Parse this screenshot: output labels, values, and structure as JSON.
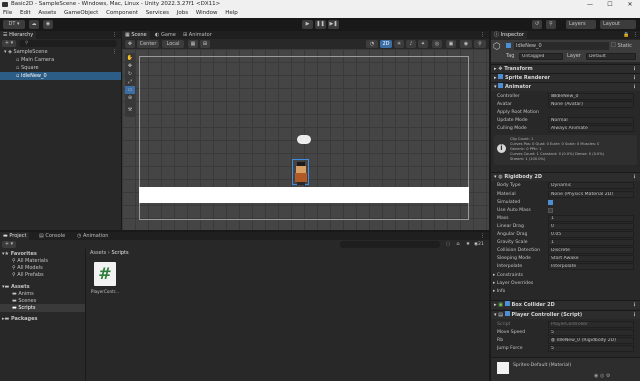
{
  "window": {
    "title": "Basic2D - SampleScene - Windows, Mac, Linux - Unity 2022.3.27f1 <DX11>",
    "min": "—",
    "max": "☐",
    "close": "✕"
  },
  "menu": [
    "File",
    "Edit",
    "Assets",
    "GameObject",
    "Component",
    "Services",
    "Jobs",
    "Window",
    "Help"
  ],
  "toolbar": {
    "account": "DT ▾",
    "play": "▶",
    "pause": "❚❚",
    "step": "▶❚",
    "layers": "Layers",
    "layout": "Layout"
  },
  "hierarchy": {
    "tab": "Hierarchy",
    "add": "+ ▾",
    "search_placeholder": "All",
    "scene": "SampleScene",
    "items": [
      "Main Camera",
      "Square",
      "IdleNew_0"
    ]
  },
  "scene": {
    "tabs": [
      "Scene",
      "Game",
      "Animator"
    ],
    "pivot": "Center",
    "space": "Local",
    "mode2d": "2D"
  },
  "project": {
    "tabs": [
      "Project",
      "Console",
      "Animation"
    ],
    "count": "21",
    "favorites_label": "Favorites",
    "favorites": [
      "All Materials",
      "All Models",
      "All Prefabs"
    ],
    "assets_label": "Assets",
    "assets": [
      "Anims",
      "Scenes",
      "Scripts"
    ],
    "packages_label": "Packages",
    "breadcrumb": [
      "Assets",
      "Scripts"
    ],
    "file_label": "PlayerContr...",
    "file_glyph": "#"
  },
  "inspector": {
    "tab": "Inspector",
    "object_name": "IdleNew_0",
    "static": "Static",
    "tag_label": "Tag",
    "tag": "Untagged",
    "layer_label": "Layer",
    "layer": "Default",
    "components": {
      "transform": "Transform",
      "sprite": "Sprite Renderer",
      "animator": "Animator",
      "rigidbody": "Rigidbody 2D",
      "box": "Box Collider 2D",
      "script": "Player Controller (Script)"
    },
    "animator_fields": [
      [
        "Controller",
        "IdleNew_0"
      ],
      [
        "Avatar",
        "None (Avatar)"
      ],
      [
        "Apply Root Motion",
        ""
      ],
      [
        "Update Mode",
        "Normal"
      ],
      [
        "Culling Mode",
        "Always Animate"
      ]
    ],
    "clip_info": [
      "Clip Count: 1",
      "Curves Pos: 0 Quat: 0 Euler: 0 Scale: 0 Muscles: 0",
      "Generic: 0 PPtr: 1",
      "Curves Count: 1 Constant: 0 (0.0%) Dense: 0 (0.0%)",
      "Stream: 1 (100.0%)"
    ],
    "rb_fields": [
      [
        "Body Type",
        "Dynamic"
      ],
      [
        "Material",
        "None (Physics Material 2D)"
      ],
      [
        "Simulated",
        ""
      ],
      [
        "Use Auto Mass",
        ""
      ],
      [
        "Mass",
        "1"
      ],
      [
        "Linear Drag",
        "0"
      ],
      [
        "Angular Drag",
        "0.05"
      ],
      [
        "Gravity Scale",
        "1"
      ],
      [
        "Collision Detection",
        "Discrete"
      ],
      [
        "Sleeping Mode",
        "Start Awake"
      ],
      [
        "Interpolate",
        "Interpolate"
      ]
    ],
    "rb_foldouts": [
      "Constraints",
      "Layer Overrides",
      "Info"
    ],
    "script_fields": [
      [
        "Script",
        "PlayerController"
      ],
      [
        "Move Speed",
        "5"
      ],
      [
        "Rb",
        "IdleNew_0 (Rigidbody 2D)"
      ],
      [
        "Jump Force",
        "5"
      ]
    ],
    "material": "Sprites-Default (Material)"
  }
}
